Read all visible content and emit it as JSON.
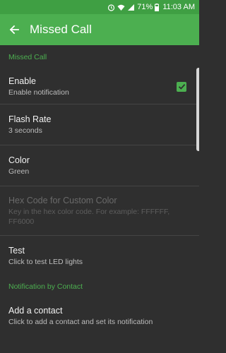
{
  "status_bar": {
    "battery": "71%",
    "time": "11:03 AM"
  },
  "app_bar": {
    "title": "Missed Call"
  },
  "sections": {
    "missed_call": {
      "header": "Missed Call",
      "enable": {
        "title": "Enable",
        "summary": "Enable notification",
        "checked": true
      },
      "flash_rate": {
        "title": "Flash Rate",
        "summary": "3 seconds"
      },
      "color": {
        "title": "Color",
        "summary": "Green"
      },
      "hex_code": {
        "title": "Hex Code for Custom Color",
        "summary": "Key in the hex color code. For example: FFFFFF, FF6000",
        "enabled": false
      },
      "test": {
        "title": "Test",
        "summary": "Click to test LED lights"
      }
    },
    "by_contact": {
      "header": "Notification by Contact",
      "add_contact": {
        "title": "Add a contact",
        "summary": "Click to add a contact and set its notification"
      }
    }
  },
  "icons": {
    "status": [
      "alarm-icon",
      "wifi-icon",
      "signal-icon",
      "battery-icon"
    ],
    "back": "back-arrow-icon",
    "check": "checkmark-icon"
  },
  "colors": {
    "accent": "#4caf50",
    "status_bar": "#3f9f43",
    "background": "#2f2f2f"
  }
}
